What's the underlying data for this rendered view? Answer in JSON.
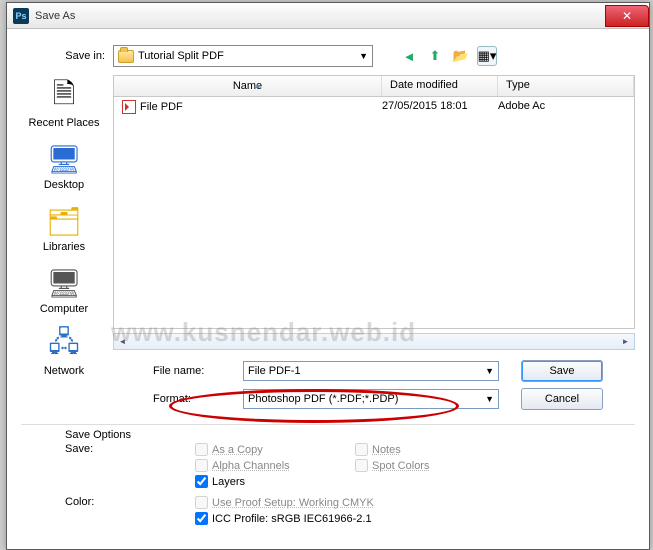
{
  "window": {
    "title": "Save As"
  },
  "savein": {
    "label": "Save in:",
    "value": "Tutorial Split PDF"
  },
  "toolbar": {
    "back": "◄",
    "up": "↑",
    "new": "✦",
    "views": "▦"
  },
  "places": [
    {
      "icon": "🖥",
      "label": "Recent Places"
    },
    {
      "icon": "🖥",
      "label": "Desktop"
    },
    {
      "icon": "📁",
      "label": "Libraries"
    },
    {
      "icon": "💻",
      "label": "Computer"
    },
    {
      "icon": "🌐",
      "label": "Network"
    }
  ],
  "columns": {
    "name": "Name",
    "date": "Date modified",
    "type": "Type"
  },
  "files": [
    {
      "name": "File PDF",
      "date": "27/05/2015 18:01",
      "type": "Adobe Ac"
    }
  ],
  "form": {
    "filename_label": "File name:",
    "filename_value": "File PDF-1",
    "format_label": "Format:",
    "format_value": "Photoshop PDF (*.PDF;*.PDP)"
  },
  "buttons": {
    "save": "Save",
    "cancel": "Cancel"
  },
  "options": {
    "header": "Save Options",
    "save_label": "Save:",
    "as_copy": "As a Copy",
    "alpha": "Alpha Channels",
    "layers": "Layers",
    "notes": "Notes",
    "spot": "Spot Colors",
    "color_label": "Color:",
    "proof": "Use Proof Setup:  Working CMYK",
    "icc": "ICC Profile:  sRGB IEC61966-2.1"
  },
  "watermark": "www.kusnendar.web.id"
}
